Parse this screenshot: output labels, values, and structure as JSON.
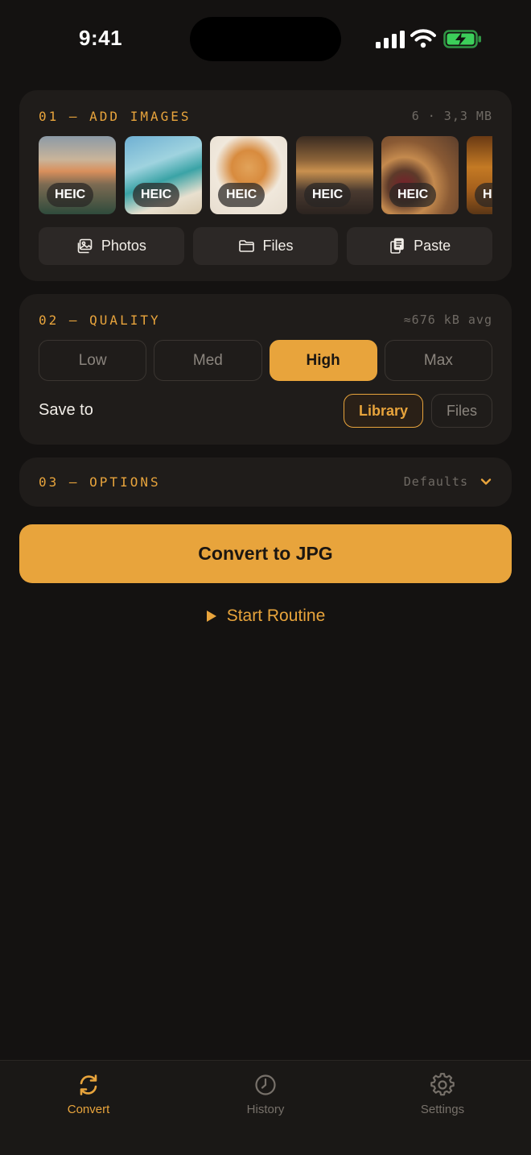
{
  "status": {
    "time": "9:41"
  },
  "add_images": {
    "title": "01 — ADD IMAGES",
    "meta": "6 · 3,3 MB",
    "thumbnails": [
      {
        "badge": "HEIC"
      },
      {
        "badge": "HEIC"
      },
      {
        "badge": "HEIC"
      },
      {
        "badge": "HEIC"
      },
      {
        "badge": "HEIC"
      },
      {
        "badge": "HEIC"
      }
    ],
    "sources": [
      {
        "label": "Photos",
        "icon": "photos-icon"
      },
      {
        "label": "Files",
        "icon": "folder-icon"
      },
      {
        "label": "Paste",
        "icon": "clipboard-icon"
      }
    ]
  },
  "quality": {
    "title": "02 — QUALITY",
    "meta": "≈676 kB avg",
    "options": [
      "Low",
      "Med",
      "High",
      "Max"
    ],
    "selected": "High",
    "save_to_label": "Save to",
    "save_options": [
      "Library",
      "Files"
    ],
    "save_selected": "Library"
  },
  "options": {
    "title": "03 — OPTIONS",
    "meta": "Defaults",
    "icon": "chevron-down-icon"
  },
  "actions": {
    "convert_label": "Convert to JPG",
    "routine_label": "Start Routine"
  },
  "tabs": [
    {
      "label": "Convert",
      "icon": "convert-icon",
      "active": true
    },
    {
      "label": "History",
      "icon": "clock-icon",
      "active": false
    },
    {
      "label": "Settings",
      "icon": "gear-icon",
      "active": false
    }
  ],
  "colors": {
    "accent": "#e8a43c",
    "background": "#141211",
    "card": "#1f1c1a"
  }
}
